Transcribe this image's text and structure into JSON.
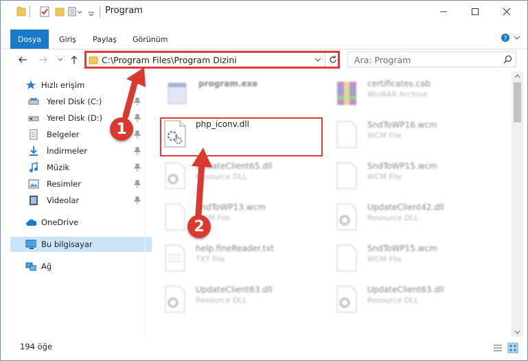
{
  "window": {
    "title": "Program",
    "controls": {
      "minimize": "—",
      "maximize": "☐",
      "close": "✕"
    }
  },
  "ribbon": {
    "tabs": [
      {
        "label": "Dosya",
        "active": true
      },
      {
        "label": "Giriş"
      },
      {
        "label": "Paylaş"
      },
      {
        "label": "Görünüm"
      }
    ]
  },
  "address_bar": {
    "path": "C:\\Program Files\\Program Dizini",
    "dropdown_icon": "chevron-down-icon",
    "refresh_icon": "refresh-icon"
  },
  "search": {
    "placeholder": "Ara: Program"
  },
  "sidebar": {
    "items": [
      {
        "label": "Hızlı erişim",
        "icon": "star-icon"
      },
      {
        "label": "Yerel Disk (C:)",
        "icon": "drive-icon",
        "pinned": true
      },
      {
        "label": "Yerel Disk (D:)",
        "icon": "drive-icon",
        "pinned": true
      },
      {
        "label": "Belgeler",
        "icon": "documents-icon",
        "pinned": true
      },
      {
        "label": "İndirmeler",
        "icon": "download-icon",
        "pinned": true
      },
      {
        "label": "Müzik",
        "icon": "music-icon",
        "pinned": true
      },
      {
        "label": "Resimler",
        "icon": "pictures-icon",
        "pinned": true
      },
      {
        "label": "Videolar",
        "icon": "videos-icon",
        "pinned": true
      },
      {
        "label": "OneDrive",
        "icon": "cloud-icon"
      },
      {
        "label": "Bu bilgisayar",
        "icon": "computer-icon",
        "selected": true
      },
      {
        "label": "Ağ",
        "icon": "network-icon"
      }
    ]
  },
  "files": [
    {
      "name": "program.exe",
      "type": ""
    },
    {
      "name": "certificates.cab",
      "type": "WinRAR Archive"
    },
    {
      "name": "php_iconv.dll",
      "type": "",
      "highlighted": true
    },
    {
      "name": "SndToWP16.wcm",
      "type": "WCM File"
    },
    {
      "name": "UpdateClient65.dll",
      "type": "Resource DLL"
    },
    {
      "name": "SndToWP15.wcm",
      "type": "WCM File"
    },
    {
      "name": "SndToWP13.wcm",
      "type": "WCM File"
    },
    {
      "name": "UpdateClient42.dll",
      "type": "Resource DLL"
    },
    {
      "name": "help.fineReader.txt",
      "type": "TXT File"
    },
    {
      "name": "SndToWP15.wcm",
      "type": "WCM File"
    },
    {
      "name": "UpdateClient63.dll",
      "type": "Resource DLL"
    },
    {
      "name": "UpdateClient63.dll",
      "type": "Resource DLL"
    }
  ],
  "status": {
    "count": "194 öğe"
  },
  "callouts": [
    "1",
    "2"
  ],
  "colors": {
    "accent": "#1979ca",
    "highlight": "#e53935",
    "selected_bg": "#cce4f7"
  }
}
